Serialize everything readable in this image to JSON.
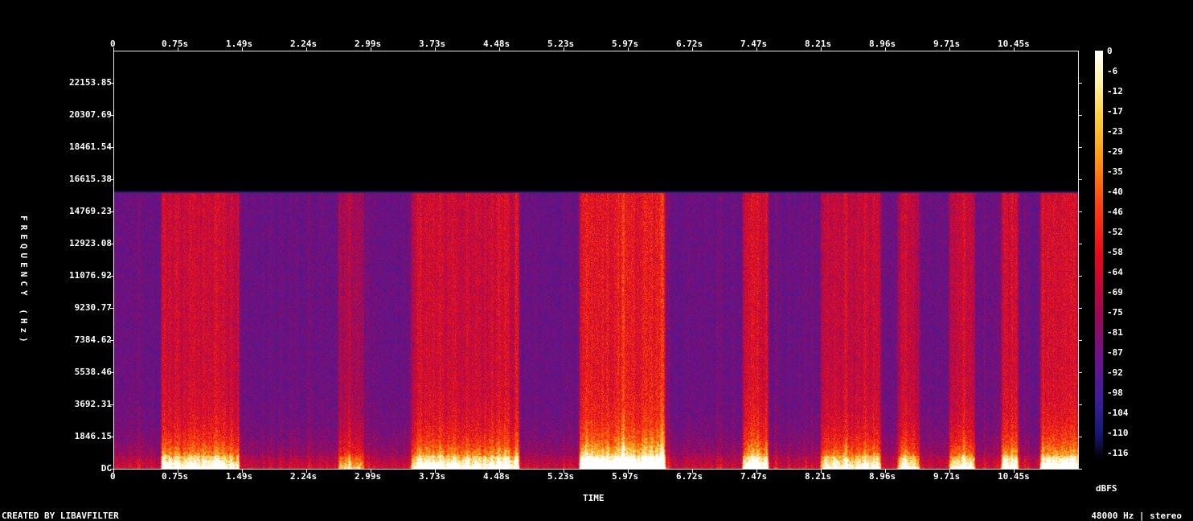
{
  "chart_data": {
    "type": "heatmap",
    "title": "",
    "xlabel": "TIME",
    "ylabel": "FREQUENCY (Hz)",
    "x_ticks": [
      "0",
      "0.75s",
      "1.49s",
      "2.24s",
      "2.99s",
      "3.73s",
      "4.48s",
      "5.23s",
      "5.97s",
      "6.72s",
      "7.47s",
      "8.21s",
      "8.96s",
      "9.71s",
      "10.45s"
    ],
    "y_ticks": [
      "DC",
      "1846.15",
      "3692.31",
      "5538.46",
      "7384.62",
      "9230.77",
      "11076.92",
      "12923.08",
      "14769.23",
      "16615.38",
      "18461.54",
      "20307.69",
      "22153.85"
    ],
    "xlim": [
      0,
      11.2
    ],
    "ylim": [
      0,
      24000
    ],
    "colorbar": {
      "label": "dBFS",
      "ticks": [
        "0",
        "-6",
        "-12",
        "-17",
        "-23",
        "-29",
        "-35",
        "-40",
        "-46",
        "-52",
        "-58",
        "-64",
        "-69",
        "-75",
        "-81",
        "-87",
        "-92",
        "-98",
        "-104",
        "-110",
        "-116"
      ],
      "range": [
        -120,
        0
      ],
      "colormap": "intensity"
    },
    "cutoff_hz": 15900,
    "footer_left": "CREATED BY LIBAVFILTER",
    "footer_right": "48000 Hz | stereo",
    "colors": {
      "background": "#000000",
      "axis": "#e8e8e8",
      "text": "#ffffff"
    }
  }
}
